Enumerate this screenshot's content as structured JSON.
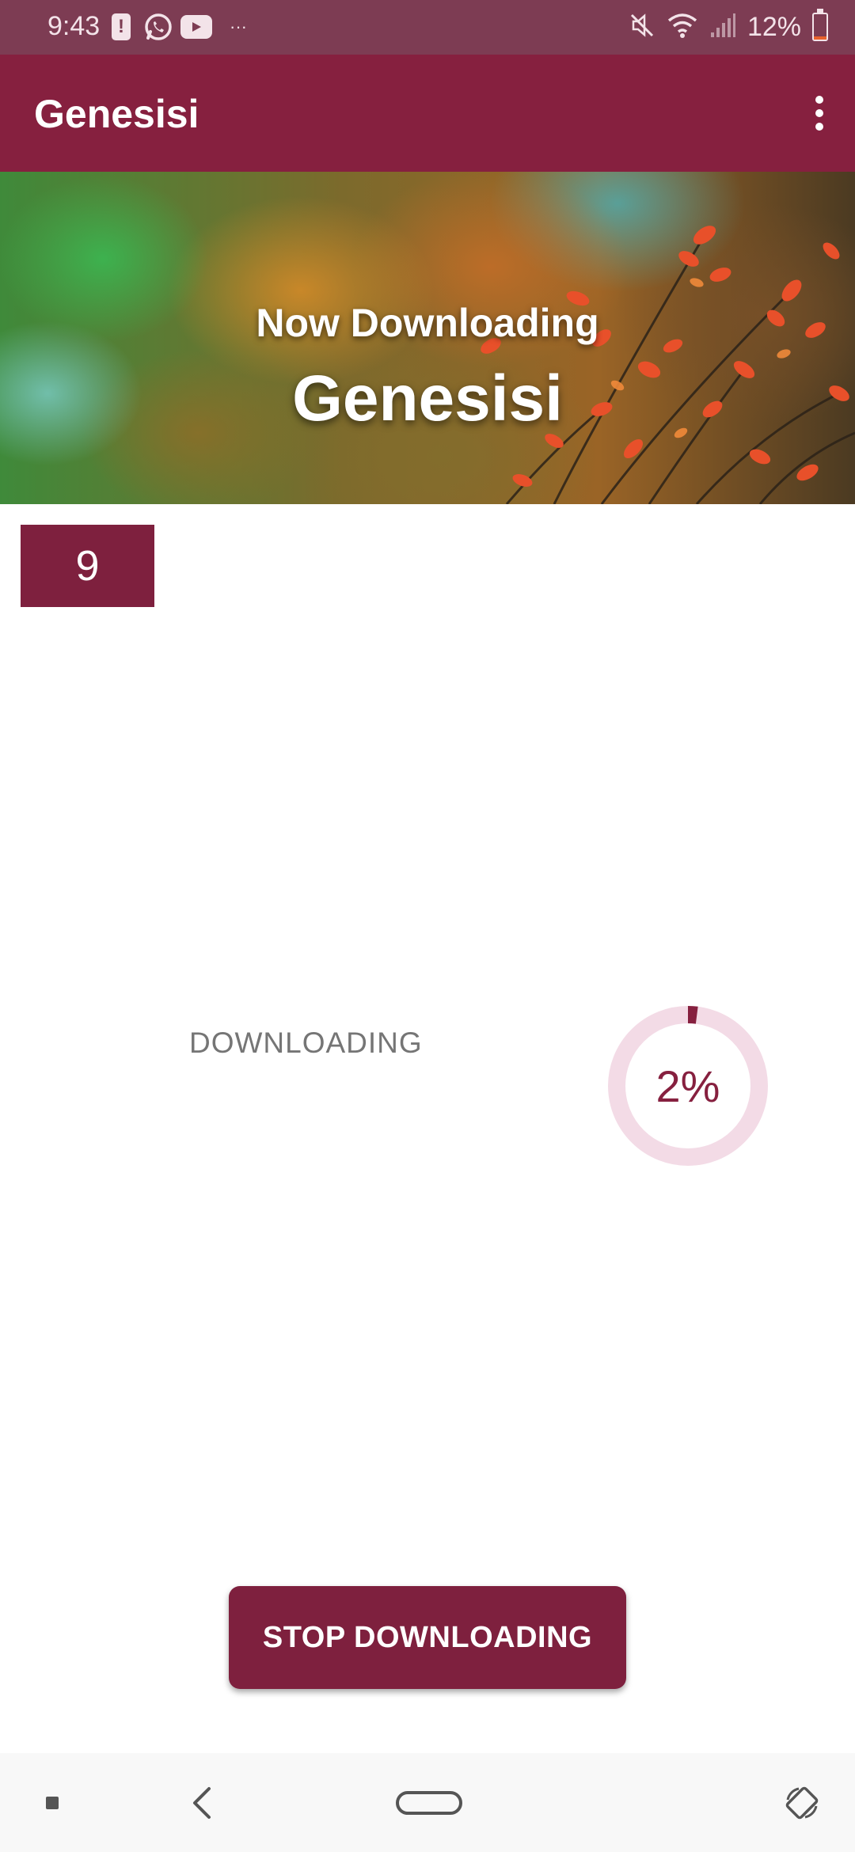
{
  "status_bar": {
    "time": "9:43",
    "more_indicator": "···",
    "battery_percent": "12%",
    "battery_level": 0.12,
    "icons": [
      "alert-icon",
      "whatsapp-icon",
      "youtube-icon",
      "mute-icon",
      "wifi-icon",
      "signal-icon",
      "battery-icon"
    ]
  },
  "app_bar": {
    "title": "Genesisi",
    "menu_icon": "more-vert-icon"
  },
  "banner": {
    "subtitle": "Now Downloading",
    "title": "Genesisi"
  },
  "chapter": {
    "number": "9"
  },
  "download": {
    "status_label": "DOWNLOADING",
    "progress_text": "2%",
    "progress_value": 0.02
  },
  "actions": {
    "stop_label": "STOP DOWNLOADING"
  },
  "nav_bar": {
    "icons": [
      "recents-icon",
      "back-icon",
      "home-icon",
      "rotate-icon"
    ]
  },
  "colors": {
    "primary": "#86203f",
    "primary_dark": "#7d3c53",
    "accent_button": "#7e203e",
    "progress_track": "#f3dbe6",
    "progress_fill": "#86203f",
    "muted_text": "#757575"
  }
}
